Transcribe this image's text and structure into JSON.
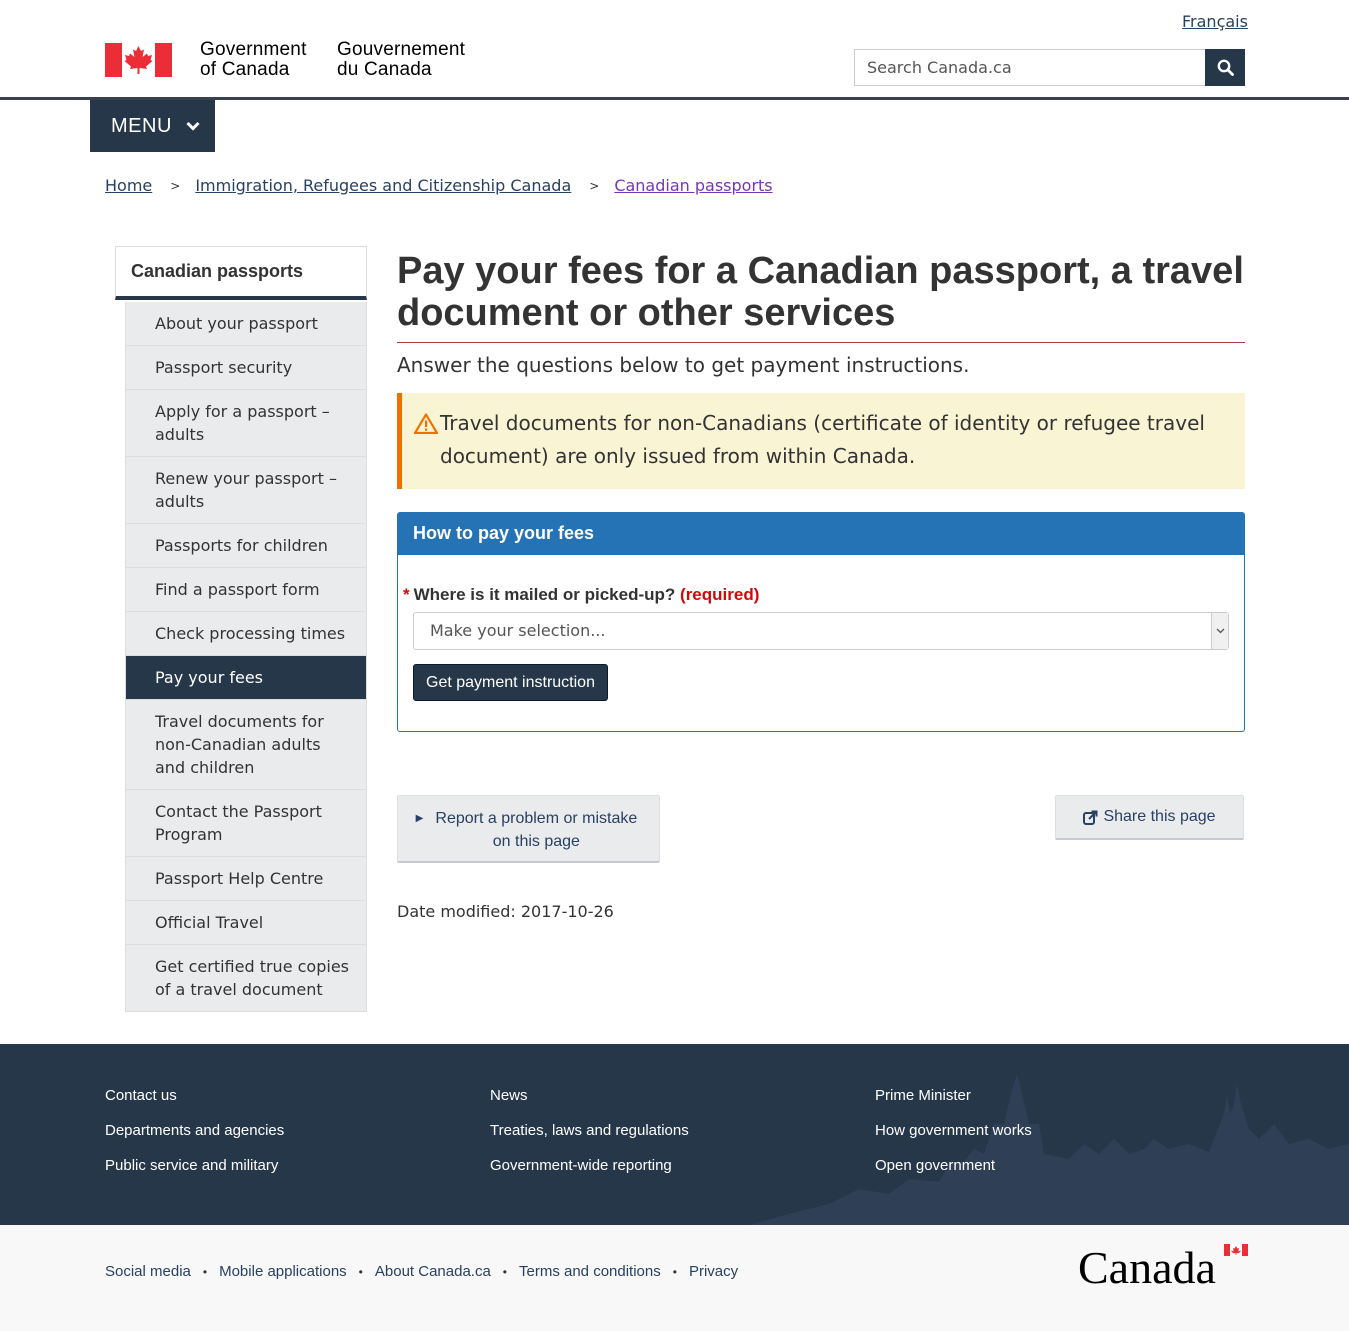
{
  "header": {
    "language_link": "Français",
    "signature_en_line1": "Government",
    "signature_en_line2": "of Canada",
    "signature_fr_line1": "Gouvernement",
    "signature_fr_line2": "du Canada",
    "search_placeholder": "Search Canada.ca",
    "menu_label": "MENU"
  },
  "breadcrumb": [
    "Home",
    "Immigration, Refugees and Citizenship Canada",
    "Canadian passports"
  ],
  "sidebar": {
    "title": "Canadian passports",
    "items": [
      {
        "label": "About your passport"
      },
      {
        "label": "Passport security"
      },
      {
        "label": "Apply for a passport – adults"
      },
      {
        "label": "Renew your passport – adults"
      },
      {
        "label": "Passports for children"
      },
      {
        "label": "Find a passport form"
      },
      {
        "label": "Check processing times"
      },
      {
        "label": "Pay your fees",
        "active": true
      },
      {
        "label": "Travel documents for non-Canadian adults and children"
      },
      {
        "label": "Contact the Passport Program"
      },
      {
        "label": "Passport Help Centre"
      },
      {
        "label": "Official Travel"
      },
      {
        "label": "Get certified true copies of a travel document"
      }
    ]
  },
  "main": {
    "title": "Pay your fees for a Canadian passport, a travel document or other services",
    "lead": "Answer the questions below to get payment instructions.",
    "alert": "Travel documents for non-Canadians (certificate of identity or refugee travel document) are only issued from within Canada.",
    "panel_title": "How to pay your fees",
    "question_star": "*",
    "question_label": "Where is it mailed or picked-up?",
    "question_required": "(required)",
    "select_value": "Make your selection...",
    "submit_label": "Get payment instruction",
    "report_label": "Report a problem or mistake on this page",
    "share_label": "Share this page",
    "date_modified": "Date modified: 2017-10-26"
  },
  "footer": {
    "col1": [
      "Contact us",
      "Departments and agencies",
      "Public service and military"
    ],
    "col2": [
      "News",
      "Treaties, laws and regulations",
      "Government-wide reporting"
    ],
    "col3": [
      "Prime Minister",
      "How government works",
      "Open government"
    ],
    "sub_links": [
      "Social media",
      "Mobile applications",
      "About Canada.ca",
      "Terms and conditions",
      "Privacy"
    ],
    "wordmark": "Canada"
  },
  "colors": {
    "primary_dark": "#26374a",
    "panel_blue": "#2572b4",
    "flag_red": "#eb2d37",
    "alert_bg": "#f9f4d4",
    "alert_border": "#ee7100",
    "required_red": "#d3080c"
  }
}
